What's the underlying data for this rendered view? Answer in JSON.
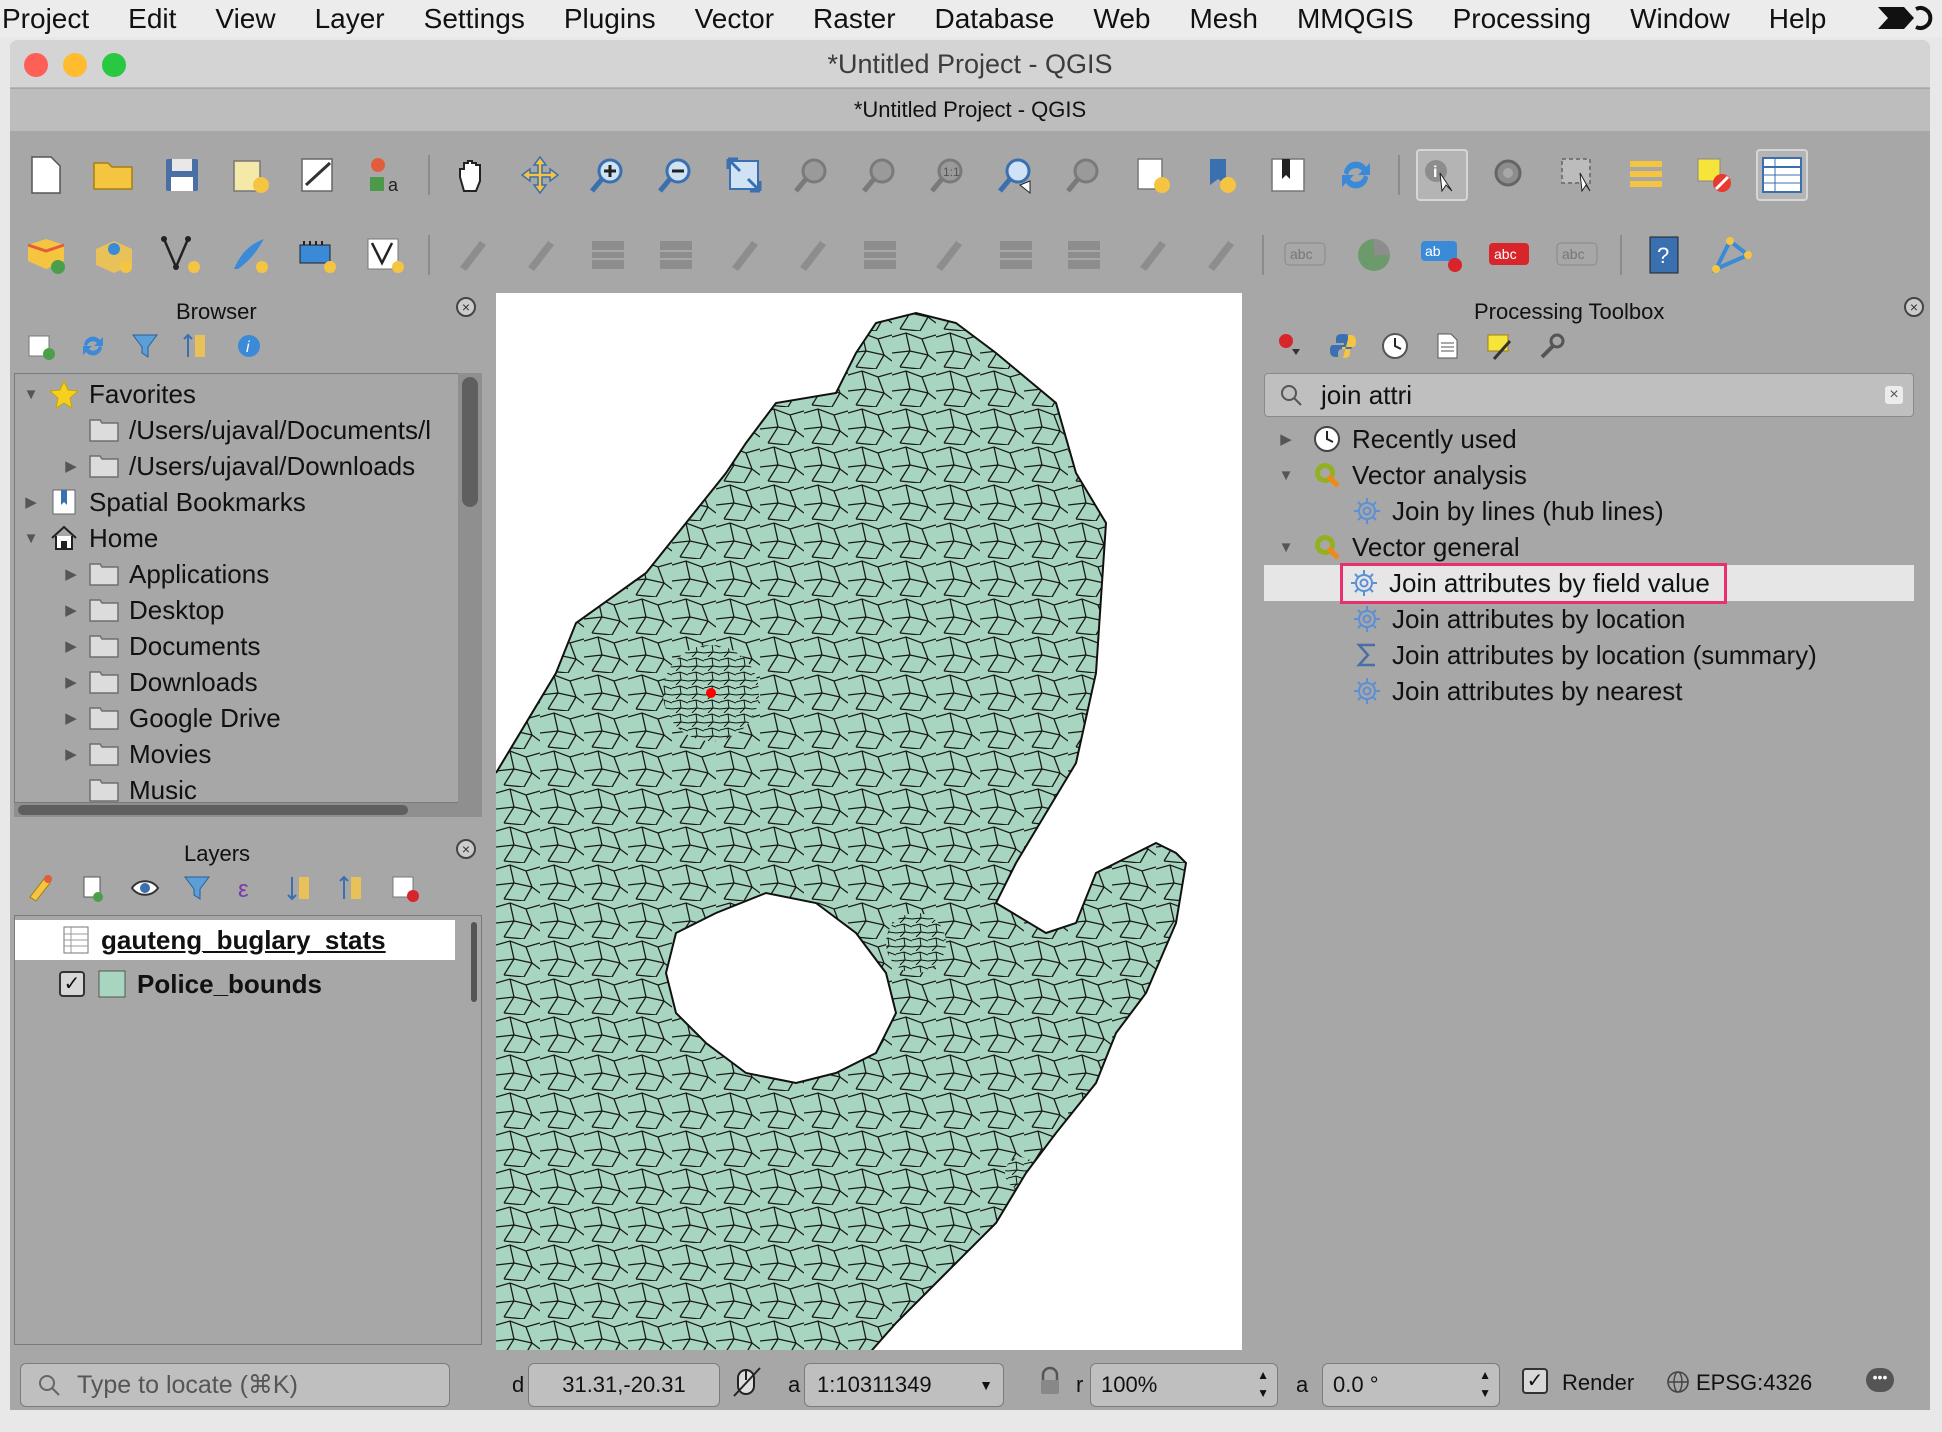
{
  "menubar": {
    "items": [
      "Project",
      "Edit",
      "View",
      "Layer",
      "Settings",
      "Plugins",
      "Vector",
      "Raster",
      "Database",
      "Web",
      "Mesh",
      "MMQGIS",
      "Processing",
      "Window",
      "Help"
    ]
  },
  "window": {
    "title": "*Untitled Project - QGIS",
    "subtitle": "*Untitled Project - QGIS"
  },
  "browser": {
    "title": "Browser",
    "items": [
      {
        "label": "Favorites",
        "icon": "star-icon",
        "arrow": "▼"
      },
      {
        "label": "/Users/ujaval/Documents/l",
        "icon": "folder-icon",
        "arrow": ""
      },
      {
        "label": "/Users/ujaval/Downloads",
        "icon": "folder-icon",
        "arrow": "▶"
      },
      {
        "label": "Spatial Bookmarks",
        "icon": "bookmark-icon",
        "arrow": "▶"
      },
      {
        "label": "Home",
        "icon": "home-icon",
        "arrow": "▼"
      },
      {
        "label": "Applications",
        "icon": "folder-icon",
        "arrow": "▶"
      },
      {
        "label": "Desktop",
        "icon": "folder-icon",
        "arrow": "▶"
      },
      {
        "label": "Documents",
        "icon": "folder-icon",
        "arrow": "▶"
      },
      {
        "label": "Downloads",
        "icon": "folder-icon",
        "arrow": "▶"
      },
      {
        "label": "Google Drive",
        "icon": "folder-icon",
        "arrow": "▶"
      },
      {
        "label": "Movies",
        "icon": "folder-icon",
        "arrow": "▶"
      },
      {
        "label": "Music",
        "icon": "folder-icon",
        "arrow": ""
      }
    ]
  },
  "layers": {
    "title": "Layers",
    "items": [
      {
        "label": "gauteng_buglary_stats",
        "type": "table"
      },
      {
        "label": "Police_bounds",
        "type": "polygon",
        "checked": true
      }
    ]
  },
  "toolbox": {
    "title": "Processing Toolbox",
    "search_value": "join attri",
    "items": [
      {
        "label": "Recently used",
        "icon": "clock-icon",
        "arrow": "▶"
      },
      {
        "label": "Vector analysis",
        "icon": "qgis-icon",
        "arrow": "▼"
      },
      {
        "label": "Join by lines (hub lines)",
        "icon": "algorithm-gear-icon",
        "arrow": ""
      },
      {
        "label": "Vector general",
        "icon": "qgis-icon",
        "arrow": "▼"
      },
      {
        "label": "Join attributes by field value",
        "icon": "algorithm-gear-icon",
        "arrow": "",
        "selected": true
      },
      {
        "label": "Join attributes by location",
        "icon": "algorithm-gear-icon",
        "arrow": ""
      },
      {
        "label": "Join attributes by location (summary)",
        "icon": "sigma-icon",
        "arrow": ""
      },
      {
        "label": "Join attributes by nearest",
        "icon": "algorithm-gear-icon",
        "arrow": ""
      }
    ],
    "highlight_color": "#e8306e"
  },
  "statusbar": {
    "locate_placeholder": "Type to locate (⌘K)",
    "coordinate_label": "d",
    "coordinate": "31.31,-20.31",
    "scale_label": "a",
    "scale": "1:10311349",
    "magnifier_label": "r",
    "magnifier": "100%",
    "rotation_label": "a",
    "rotation": "0.0 °",
    "render_label": "Render",
    "crs": "EPSG:4326"
  },
  "colors": {
    "polygon_fill": "#a8d5bf",
    "accent": "#e8306e"
  }
}
